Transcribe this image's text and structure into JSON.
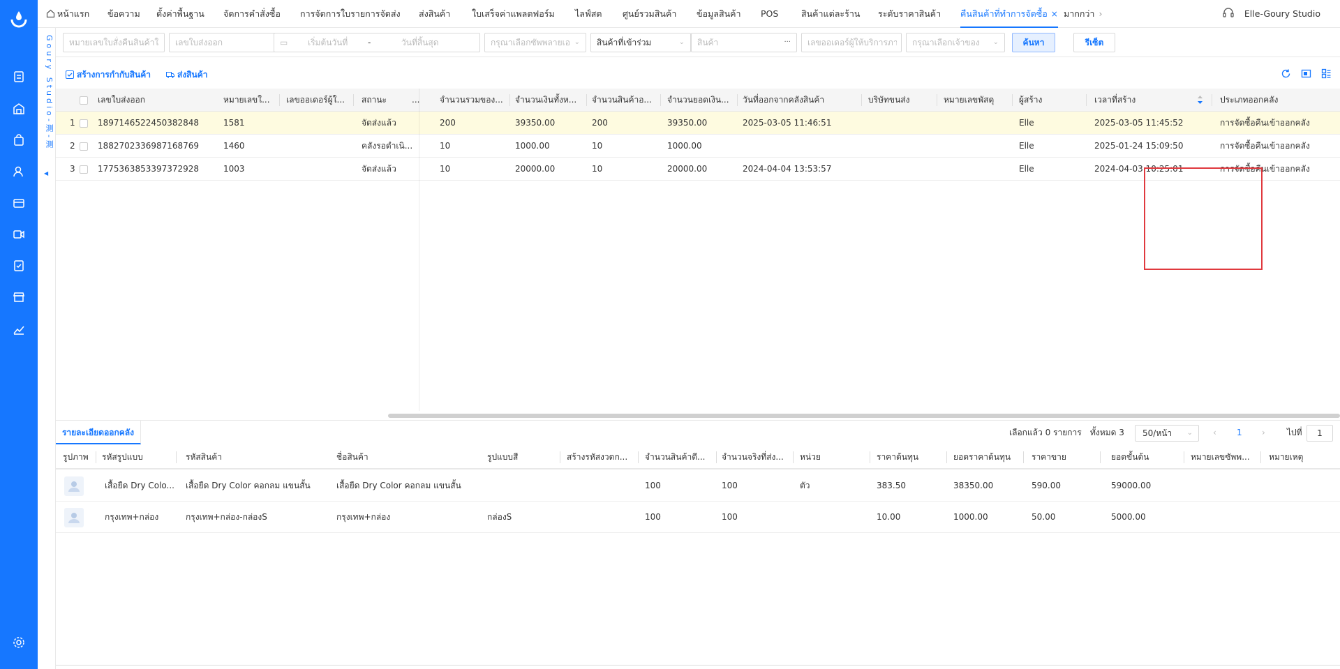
{
  "app": {
    "store_name": "Elle-Goury Studio",
    "vertical_label": "Goury Studio-测-测",
    "accent_color": "#1677ff",
    "highlight_color": "#e0393e",
    "selected_row_color": "#fefbe0"
  },
  "nav_tabs": [
    {
      "label": "หน้าแรก",
      "icon": "home-icon"
    },
    {
      "label": "ข้อความ"
    },
    {
      "label": "ตั้งค่าพื้นฐาน"
    },
    {
      "label": "จัดการคำสั่งซื้อ"
    },
    {
      "label": "การจัดการใบรายการจัดส่ง"
    },
    {
      "label": "ส่งสินค้า"
    },
    {
      "label": "ใบเสร็จค่าแพลตฟอร์ม"
    },
    {
      "label": "ไลฟ์สด"
    },
    {
      "label": "ศูนย์รวมสินค้า"
    },
    {
      "label": "ข้อมูลสินค้า"
    },
    {
      "label": "POS"
    },
    {
      "label": "สินค้าแต่ละร้าน"
    },
    {
      "label": "ระดับราคาสินค้า"
    },
    {
      "label": "คืนสินค้าที่ทำการจัดซื้อ",
      "active": true,
      "close": "×"
    },
    {
      "label": "มากกว่า",
      "chevron": "›"
    }
  ],
  "left_icons": [
    "logo-icon",
    "document-icon",
    "warehouse-icon",
    "shopping-bag-icon",
    "user-icon",
    "wallet-icon",
    "video-icon",
    "checklist-icon",
    "store-icon",
    "chart-icon",
    "settings-icon"
  ],
  "filters": {
    "return_order_no": "หมายเลขใบสั่งคืนสินค้าใ",
    "dispatch_no": "เลขใบส่งออก",
    "start_date": "เริ่มต้นวันที่",
    "date_sep": "-",
    "end_date": "วันที่สิ้นสุด",
    "supplier": "กรุณาเลือกซัพพลายเอ",
    "product_type": "สินค้าที่เข้าร่วม",
    "product": "สินค้า",
    "product_more": "···",
    "service_phone": "เลขออเดอร์ผู้ให้บริการภาย",
    "owner": "กรุณาเลือกเจ้าของ",
    "search_button": "ค้นหา",
    "reset_button": "รีเซ็ต"
  },
  "actions": {
    "create_return": "สร้างการกำกับสินค้า",
    "ship_goods": "ส่งสินค้า"
  },
  "grid": {
    "columns": [
      "เลขใบส่งออก",
      "หมายเลขใ...",
      "เลขออเดอร์ผู้ใ...",
      "สถานะ",
      "...",
      "จำนวนรวมของ...",
      "จำนวนเงินทั้งห...",
      "จำนวนสินค้าอ...",
      "จำนวนยอดเงิน...",
      "วันที่ออกจากคลังสินค้า",
      "บริษัทขนส่ง",
      "หมายเลขพัสดุ",
      "ผู้สร้าง",
      "เวลาที่สร้าง",
      "ประเภทออกคลัง"
    ],
    "rows": [
      {
        "idx": "1",
        "dispatch_no": "1897146522450382848",
        "ref": "1581",
        "ext": "",
        "status": "จัดส่งแล้ว",
        "qty": "200",
        "amount": "39350.00",
        "item_qty": "200",
        "total": "39350.00",
        "out_date": "2025-03-05 11:46:51",
        "carrier": "",
        "tracking": "",
        "creator": "Elle",
        "created_at": "2025-03-05 11:45:52",
        "out_type": "การจัดซื้อคืนเข้าออกคลัง"
      },
      {
        "idx": "2",
        "dispatch_no": "1882702336987168769",
        "ref": "1460",
        "ext": "",
        "status": "คลังรอดำเนิ...",
        "qty": "10",
        "amount": "1000.00",
        "item_qty": "10",
        "total": "1000.00",
        "out_date": "",
        "carrier": "",
        "tracking": "",
        "creator": "Elle",
        "created_at": "2025-01-24 15:09:50",
        "out_type": "การจัดซื้อคืนเข้าออกคลัง"
      },
      {
        "idx": "3",
        "dispatch_no": "1775363853397372928",
        "ref": "1003",
        "ext": "",
        "status": "จัดส่งแล้ว",
        "qty": "10",
        "amount": "20000.00",
        "item_qty": "10",
        "total": "20000.00",
        "out_date": "2024-04-04 13:53:57",
        "carrier": "",
        "tracking": "",
        "creator": "Elle",
        "created_at": "2024-04-03 10:25:01",
        "out_type": "การจัดซื้อคืนเข้าออกคลัง"
      }
    ]
  },
  "detail": {
    "tab_label": "รายละเอียดออกคลัง",
    "selected_text": "เลือกแล้ว 0 รายการ",
    "total_text": "ทั้งหมด 3",
    "page_size": "50/หน้า",
    "page_current": "1",
    "goto_label": "ไปที่",
    "goto_value": "1",
    "columns": [
      "รูปภาพ",
      "รหัสรูปแบบ",
      "รหัสสินค้า",
      "ชื่อสินค้า",
      "รูปแบบสี",
      "สร้างรหัสงวดก...",
      "จำนวนสินค้าตี...",
      "จำนวนจริงที่ส่ง...",
      "หน่วย",
      "ราคาต้นทุน",
      "ยอดราคาต้นทุน",
      "ราคาขาย",
      "ยอดขั้นต้น",
      "หมายเลขซัพพ...",
      "หมายเหตุ"
    ],
    "rows": [
      {
        "style_code": "เสื้อยืด Dry Colo...",
        "sku": "เสื้อยืด Dry Color คอกลม แขนสั้น",
        "name": "เสื้อยืด Dry Color คอกลม แขนสั้น",
        "color": "",
        "batch": "",
        "plan_qty": "100",
        "actual_qty": "100",
        "unit": "ตัว",
        "cost": "383.50",
        "cost_total": "38350.00",
        "price": "590.00",
        "gross": "59000.00",
        "supplier_no": "",
        "note": ""
      },
      {
        "style_code": "กรุงเทพ+กล่อง",
        "sku": "กรุงเทพ+กล่อง-กล่องS",
        "name": "กรุงเทพ+กล่อง",
        "color": "กล่องS",
        "batch": "",
        "plan_qty": "100",
        "actual_qty": "100",
        "unit": "",
        "cost": "10.00",
        "cost_total": "1000.00",
        "price": "50.00",
        "gross": "5000.00",
        "supplier_no": "",
        "note": ""
      }
    ]
  }
}
